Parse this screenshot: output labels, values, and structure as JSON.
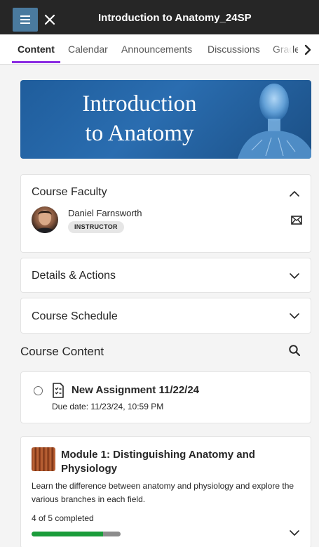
{
  "header": {
    "title": "Introduction to Anatomy_24SP",
    "menu_icon": "hamburger-icon",
    "close_icon": "close-icon"
  },
  "tabs": [
    {
      "label": "Content",
      "active": true
    },
    {
      "label": "Calendar",
      "active": false
    },
    {
      "label": "Announcements",
      "active": false
    },
    {
      "label": "Discussions",
      "active": false
    },
    {
      "label": "Grade",
      "active": false
    }
  ],
  "banner": {
    "line1": "Introduction",
    "line2": "to Anatomy"
  },
  "faculty": {
    "title": "Course Faculty",
    "name": "Daniel Farnsworth",
    "role": "INSTRUCTOR"
  },
  "details": {
    "title": "Details & Actions"
  },
  "schedule": {
    "title": "Course Schedule"
  },
  "content": {
    "heading": "Course Content",
    "assignment": {
      "title": "New Assignment 11/22/24",
      "due": "Due date: 11/23/24, 10:59 PM"
    },
    "module": {
      "title": "Module 1: Distinguishing Anatomy and Physiology",
      "description": "Learn the difference between anatomy and physiology and explore the various branches in each field.",
      "progress_label": "4 of 5 completed",
      "progress_fraction": 0.8
    }
  },
  "colors": {
    "header_bg": "#262626",
    "menu_btn": "#4a7a9e",
    "tab_accent": "#8a2be2",
    "progress": "#1a9c3a"
  }
}
